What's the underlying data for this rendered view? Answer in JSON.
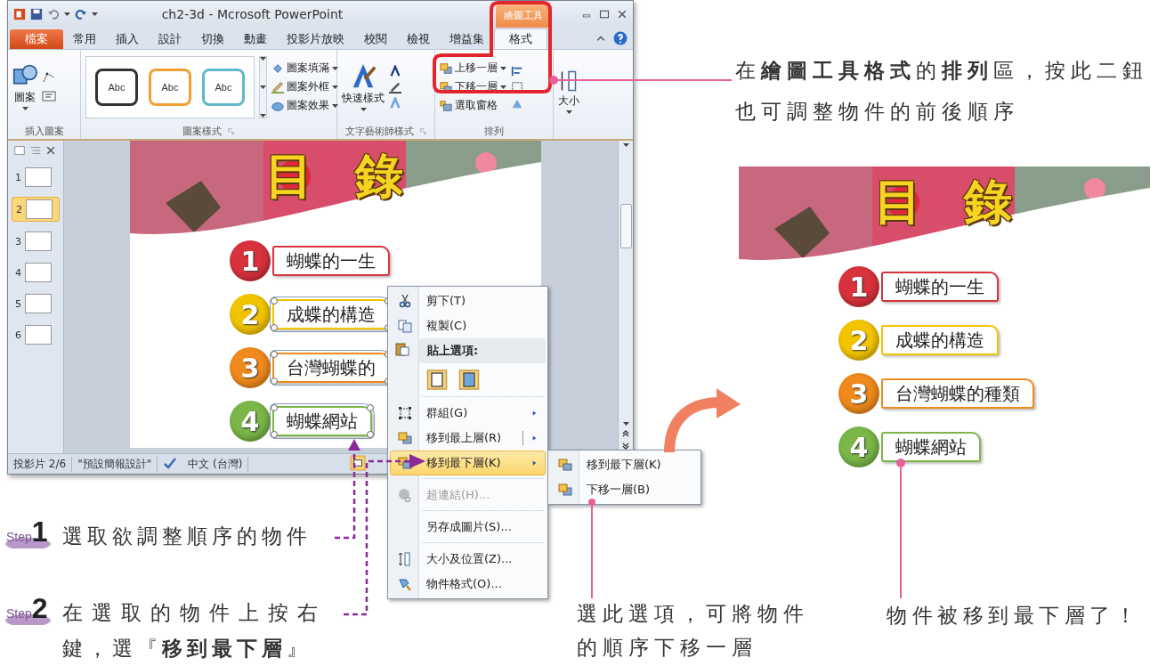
{
  "window": {
    "title": "ch2-3d - Mcrosoft PowerPoint",
    "context_tab": "繪圖工具"
  },
  "tabs": [
    {
      "label": "檔案",
      "kind": "file",
      "selected": false
    },
    {
      "label": "常用",
      "kind": "tab",
      "selected": false
    },
    {
      "label": "插入",
      "kind": "tab",
      "selected": false
    },
    {
      "label": "設計",
      "kind": "tab",
      "selected": false
    },
    {
      "label": "切換",
      "kind": "tab",
      "selected": false
    },
    {
      "label": "動畫",
      "kind": "tab",
      "selected": false
    },
    {
      "label": "投影片放映",
      "kind": "tab",
      "selected": false
    },
    {
      "label": "校閱",
      "kind": "tab",
      "selected": false
    },
    {
      "label": "檢視",
      "kind": "tab",
      "selected": false
    },
    {
      "label": "增益集",
      "kind": "tab",
      "selected": false
    },
    {
      "label": "格式",
      "kind": "tab",
      "selected": true
    }
  ],
  "ribbon": {
    "insert_shapes": {
      "label": "插入圖案",
      "button": "圖案"
    },
    "shape_styles": {
      "label": "圖案樣式",
      "samples": [
        {
          "text": "Abc",
          "color": "#333333"
        },
        {
          "text": "Abc",
          "color": "#f0a030"
        },
        {
          "text": "Abc",
          "color": "#60b8c8"
        }
      ],
      "commands": [
        "圖案填滿",
        "圖案外框",
        "圖案效果"
      ]
    },
    "wordart": {
      "label": "文字藝術師樣式",
      "button": "快速樣式"
    },
    "arrange": {
      "label": "排列",
      "commands": [
        "上移一層",
        "下移一層",
        "選取窗格"
      ]
    },
    "size": {
      "button": "大小"
    }
  },
  "thumbnails": [
    {
      "number": "1",
      "selected": false
    },
    {
      "number": "2",
      "selected": true
    },
    {
      "number": "3",
      "selected": false
    },
    {
      "number": "4",
      "selected": false
    },
    {
      "number": "5",
      "selected": false
    },
    {
      "number": "6",
      "selected": false
    }
  ],
  "slide": {
    "title": "目 錄",
    "items": [
      {
        "number": "1",
        "text": "蝴蝶的一生",
        "color": "#d8323c",
        "selected": false
      },
      {
        "number": "2",
        "text": "成蝶的構造",
        "color": "#f2c400",
        "selected": true
      },
      {
        "number": "3",
        "text": "台灣蝴蝶的",
        "color": "#f08a1c",
        "selected": true
      },
      {
        "number": "4",
        "text": "蝴蝶網站",
        "color": "#7ab648",
        "selected": true
      }
    ]
  },
  "status_bar": [
    "投影片 2/6",
    "\"預設簡報設計\"",
    "中文 (台灣)"
  ],
  "context_menu": {
    "items": [
      {
        "kind": "command",
        "label": "剪下(T)",
        "submenu": false,
        "disabled": false,
        "selected": false
      },
      {
        "kind": "command",
        "label": "複製(C)",
        "submenu": false,
        "disabled": false,
        "selected": false
      },
      {
        "kind": "header",
        "label": "貼上選項:"
      },
      {
        "kind": "paste_options"
      },
      {
        "kind": "separator"
      },
      {
        "kind": "command",
        "label": "群組(G)",
        "submenu": true,
        "disabled": false,
        "selected": false
      },
      {
        "kind": "command",
        "label": "移到最上層(R)",
        "submenu": true,
        "disabled": false,
        "selected": false
      },
      {
        "kind": "command",
        "label": "移到最下層(K)",
        "submenu": true,
        "disabled": false,
        "selected": true
      },
      {
        "kind": "separator"
      },
      {
        "kind": "command",
        "label": "超連結(H)...",
        "submenu": false,
        "disabled": true,
        "selected": false
      },
      {
        "kind": "separator"
      },
      {
        "kind": "command",
        "label": "另存成圖片(S)...",
        "submenu": false,
        "disabled": false,
        "selected": false
      },
      {
        "kind": "separator"
      },
      {
        "kind": "command",
        "label": "大小及位置(Z)...",
        "submenu": false,
        "disabled": false,
        "selected": false
      },
      {
        "kind": "command",
        "label": "物件格式(O)...",
        "submenu": false,
        "disabled": false,
        "selected": false
      }
    ]
  },
  "submenu": {
    "items": [
      "移到最下層(K)",
      "下移一層(B)"
    ]
  },
  "callouts": {
    "ribbon_note": "在**繪圖工具格式**的**排列**區，按此二鈕也可調整物件的前後順序",
    "submenu_note": "選此選項，可將物件的順序下移一層",
    "result_note": "物件被移到最下層了！"
  },
  "steps": [
    {
      "label": "Step",
      "number": "1",
      "text": "選取欲調整順序的物件"
    },
    {
      "label": "Step",
      "number": "2",
      "text": "在選取的物件上按右鍵，選『**移到最下層**』"
    }
  ],
  "result_slide": {
    "title": "目 錄",
    "items": [
      {
        "number": "1",
        "text": "蝴蝶的一生",
        "color": "#d8323c",
        "selected": false
      },
      {
        "number": "2",
        "text": "成蝶的構造",
        "color": "#f2c400",
        "selected": false
      },
      {
        "number": "3",
        "text": "台灣蝴蝶的種類",
        "color": "#f08a1c",
        "selected": false
      },
      {
        "number": "4",
        "text": "蝴蝶網站",
        "color": "#7ab648",
        "selected": false
      }
    ]
  }
}
